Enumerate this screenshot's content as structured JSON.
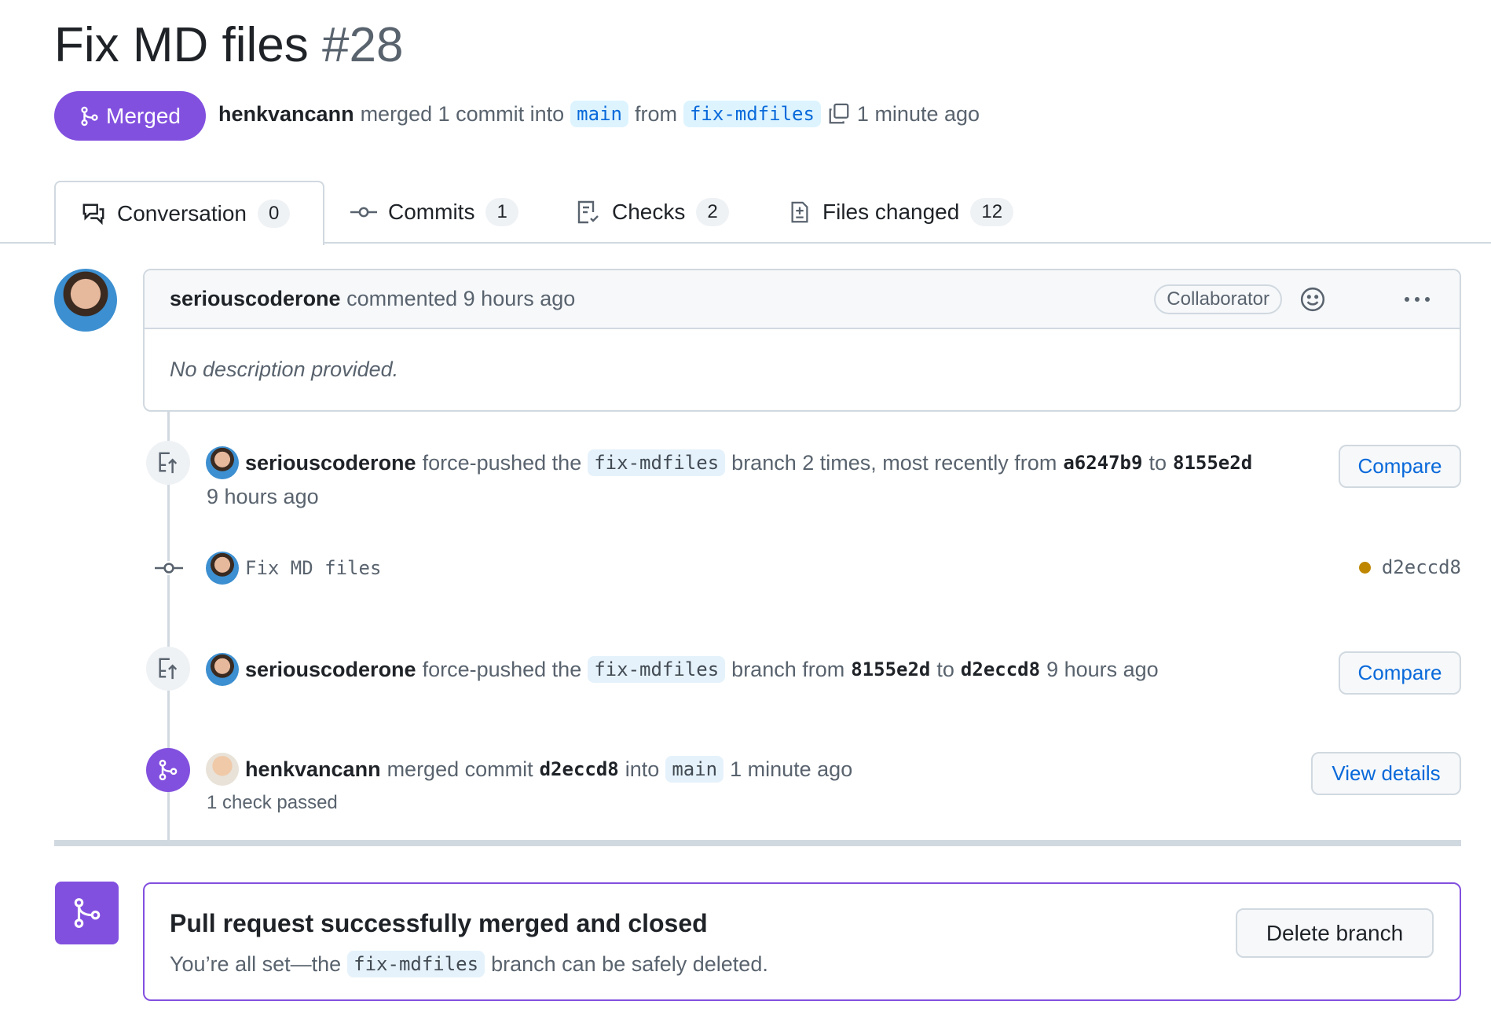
{
  "header": {
    "title": "Fix MD files",
    "number": "#28",
    "state": "Merged",
    "author": "henkvancann",
    "action": "merged 1 commit into",
    "base": "main",
    "from": "from",
    "head": "fix-mdfiles",
    "time": "1 minute ago"
  },
  "tabs": [
    {
      "label": "Conversation",
      "count": "0"
    },
    {
      "label": "Commits",
      "count": "1"
    },
    {
      "label": "Checks",
      "count": "2"
    },
    {
      "label": "Files changed",
      "count": "12"
    }
  ],
  "comment": {
    "author": "seriouscoderone",
    "action": "commented 9 hours ago",
    "badge": "Collaborator",
    "body": "No description provided."
  },
  "events": {
    "push1": {
      "author": "seriouscoderone",
      "t1": "force-pushed the",
      "branch": "fix-mdfiles",
      "t2": "branch 2 times, most recently from",
      "from": "a6247b9",
      "to_word": "to",
      "to": "8155e2d",
      "time": "9 hours ago",
      "button": "Compare"
    },
    "commit": {
      "message": "Fix MD files",
      "sha": "d2eccd8",
      "status_color": "#bf8700"
    },
    "push2": {
      "author": "seriouscoderone",
      "t1": "force-pushed the",
      "branch": "fix-mdfiles",
      "t2": "branch from",
      "from": "8155e2d",
      "to_word": "to",
      "to": "d2eccd8",
      "time": "9 hours ago",
      "button": "Compare"
    },
    "merge": {
      "author": "henkvancann",
      "t1": "merged commit",
      "sha": "d2eccd8",
      "into": "into",
      "base": "main",
      "time": "1 minute ago",
      "checks": "1 check passed",
      "button": "View details"
    }
  },
  "merged_box": {
    "title": "Pull request successfully merged and closed",
    "t1": "You’re all set—the",
    "branch": "fix-mdfiles",
    "t2": "branch can be safely deleted.",
    "button": "Delete branch"
  },
  "colors": {
    "merged": "#8250df",
    "link": "#0969da"
  }
}
